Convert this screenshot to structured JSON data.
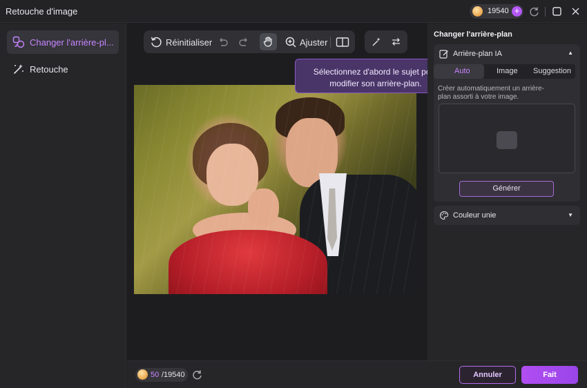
{
  "window": {
    "title": "Retouche d'image"
  },
  "header": {
    "credits": "19540",
    "plus_icon": "+"
  },
  "sidebar": {
    "items": [
      {
        "label": "Changer l'arrière-pl...",
        "icon": "change-background-icon",
        "active": true
      },
      {
        "label": "Retouche",
        "icon": "magic-wand-icon",
        "active": false
      }
    ]
  },
  "toolbar": {
    "reset_label": "Réinitialiser",
    "adjust_label": "Ajuster"
  },
  "tooltip": {
    "line1": "Sélectionnez d'abord le sujet pour",
    "line2": "modifier son arrière-plan."
  },
  "right_panel": {
    "title": "Changer l'arrière-plan",
    "ai_section": {
      "label": "Arrière-plan IA",
      "tabs": [
        {
          "label": "Auto",
          "selected": true
        },
        {
          "label": "Image",
          "selected": false
        },
        {
          "label": "Suggestion",
          "selected": false
        }
      ],
      "description_line1": "Créer automatiquement un arrière-",
      "description_line2": "plan assorti à votre image.",
      "generate_label": "Générer"
    },
    "solid_section": {
      "label": "Couleur unie"
    }
  },
  "footer": {
    "used": "50",
    "total": "/19540",
    "cancel_label": "Annuler",
    "done_label": "Fait"
  },
  "colors": {
    "accent": "#b458f5",
    "accent_text": "#c985ff",
    "background": "#1e1e21",
    "panel": "#262629"
  }
}
